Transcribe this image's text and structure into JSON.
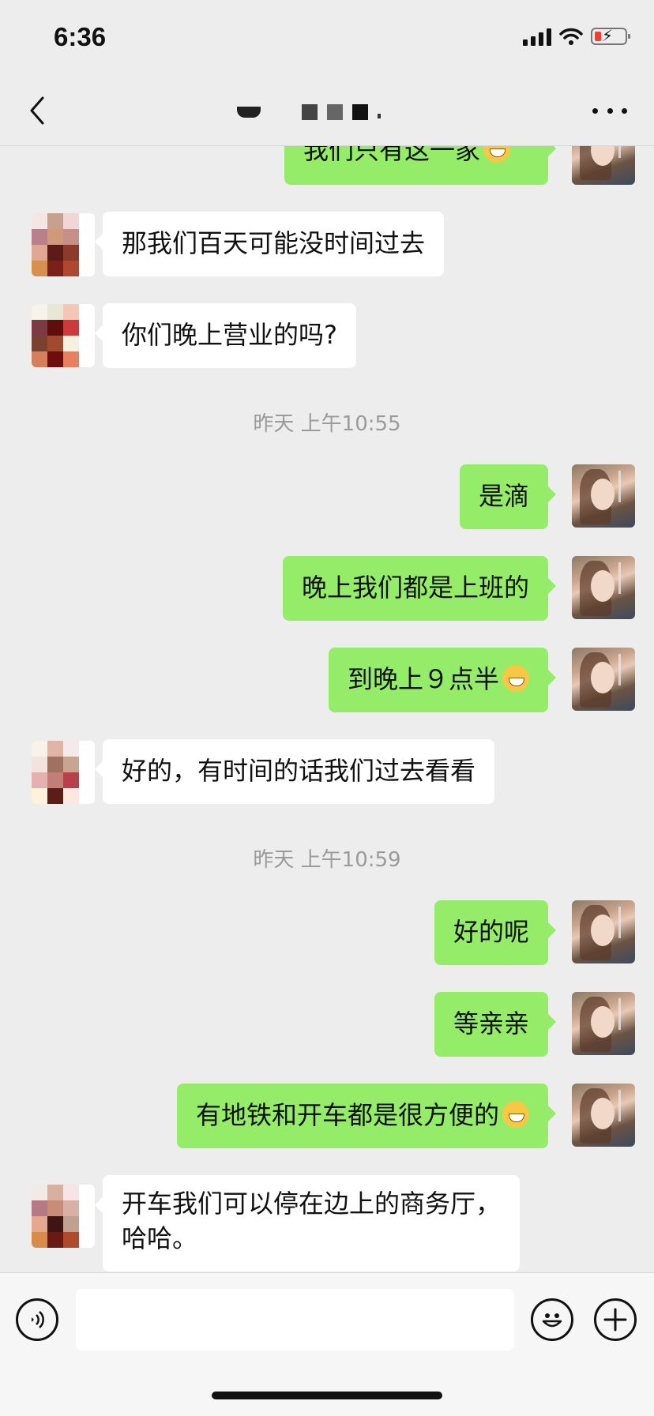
{
  "status_bar": {
    "time": "6:36"
  },
  "nav": {
    "back_icon": "chevron-left-icon",
    "more_icon": "more-dots-icon"
  },
  "messages": [
    {
      "side": "out",
      "text": "我们只有这一家",
      "emoji": "grin-emoji"
    },
    {
      "side": "in",
      "text": "那我们百天可能没时间过去"
    },
    {
      "side": "in",
      "text": "你们晚上营业的吗?"
    },
    {
      "type": "time",
      "text": "昨天 上午10:55"
    },
    {
      "side": "out",
      "text": "是滴"
    },
    {
      "side": "out",
      "text": "晚上我们都是上班的"
    },
    {
      "side": "out",
      "text": "到晚上９点半",
      "emoji": "grin-emoji"
    },
    {
      "side": "in",
      "text": "好的，有时间的话我们过去看看"
    },
    {
      "type": "time",
      "text": "昨天 上午10:59"
    },
    {
      "side": "out",
      "text": "好的呢"
    },
    {
      "side": "out",
      "text": "等亲亲"
    },
    {
      "side": "out",
      "text": "有地铁和开车都是很方便的",
      "emoji": "thinking-emoji"
    },
    {
      "side": "in",
      "text_line1": "开车我们可以停在边上的商务厅，",
      "text_line2": "哈哈。"
    }
  ],
  "input_bar": {
    "value": "",
    "voice_icon": "voice-icon",
    "emoji_icon": "emoji-icon",
    "add_icon": "plus-icon"
  },
  "colors": {
    "outgoing_bubble": "#95ec69",
    "incoming_bubble": "#ffffff",
    "background": "#ededed"
  }
}
